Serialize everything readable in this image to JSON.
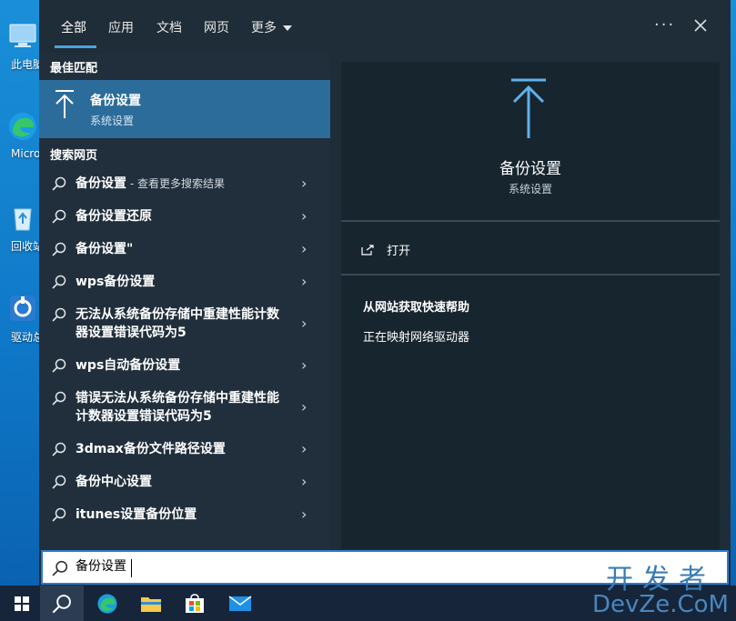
{
  "desktop_icons": [
    {
      "label": "此电脑",
      "icon": "computer-icon"
    },
    {
      "label": "Microsoft Edge",
      "icon": "edge-icon"
    },
    {
      "label": "回收站",
      "icon": "recycle-bin-icon"
    },
    {
      "label": "驱动总裁",
      "icon": "driver-tool-icon"
    }
  ],
  "tabs": [
    {
      "label": "全部",
      "active": true
    },
    {
      "label": "应用",
      "active": false
    },
    {
      "label": "文档",
      "active": false
    },
    {
      "label": "网页",
      "active": false
    },
    {
      "label": "更多",
      "active": false
    }
  ],
  "top_actions": {
    "more_icon": "ellipsis-icon",
    "close_icon": "close-icon"
  },
  "best_match": {
    "heading": "最佳匹配",
    "title": "备份设置",
    "subtitle": "系统设置",
    "icon": "backup-arrow-icon"
  },
  "web_search": {
    "heading": "搜索网页",
    "items": [
      {
        "text": "备份设置",
        "suffix": " - 查看更多搜索结果"
      },
      {
        "text": "备份设置还原",
        "suffix": ""
      },
      {
        "text": "备份设置\"",
        "suffix": ""
      },
      {
        "text": "wps备份设置",
        "suffix": ""
      },
      {
        "text": "无法从系统备份存储中重建性能计数器设置错误代码为5",
        "suffix": ""
      },
      {
        "text": "wps自动备份设置",
        "suffix": ""
      },
      {
        "text": "错误无法从系统备份存储中重建性能计数器设置错误代码为5",
        "suffix": ""
      },
      {
        "text": "3dmax备份文件路径设置",
        "suffix": ""
      },
      {
        "text": "备份中心设置",
        "suffix": ""
      },
      {
        "text": "itunes设置备份位置",
        "suffix": ""
      }
    ]
  },
  "preview": {
    "title": "备份设置",
    "subtitle": "系统设置",
    "open_label": "打开",
    "help_heading": "从网站获取快速帮助",
    "help_item": "正在映射网络驱动器"
  },
  "search": {
    "value": "备份设置"
  },
  "taskbar": {
    "items": [
      "windows-start-icon",
      "search-icon",
      "edge-icon",
      "file-explorer-icon",
      "store-icon",
      "mail-icon"
    ]
  },
  "watermark": {
    "line1": "开发者",
    "line2": "DevZe.CoM"
  },
  "colors": {
    "accent": "#2c6c9b",
    "panel": "#1f2d38",
    "taskbar": "#16253a"
  }
}
